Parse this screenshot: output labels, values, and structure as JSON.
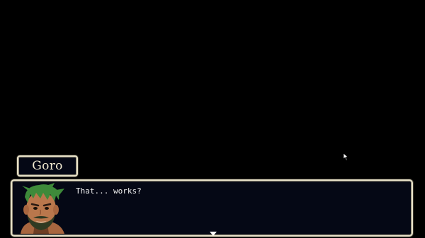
{
  "speaker": {
    "name": "Goro"
  },
  "dialog": {
    "text": "That... works?"
  },
  "icons": {
    "portrait": "goro-portrait-icon",
    "advance": "advance-arrow-icon",
    "cursor": "mouse-cursor-icon"
  },
  "colors": {
    "background": "#000000",
    "box_fill": "#050815",
    "box_border": "#e7e1c8",
    "text": "#f2f2f2",
    "hair": "#3e8a3a",
    "skin": "#b9774c"
  }
}
